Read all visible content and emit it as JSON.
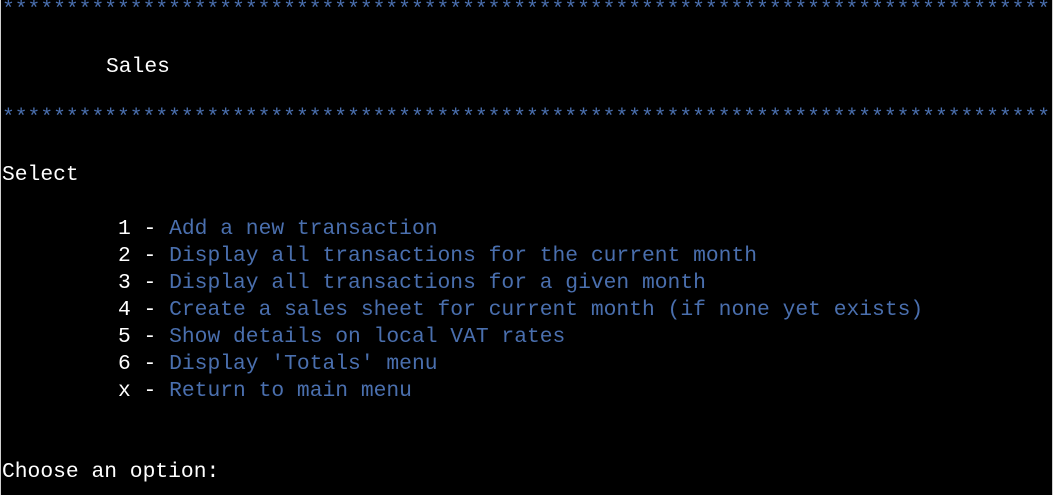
{
  "stars_top": "**********************************************************************************",
  "stars_bottom": "**********************************************************************************",
  "title": "Sales",
  "select_label": "Select",
  "menu": [
    {
      "key": "1",
      "sep": " - ",
      "label": "Add a new transaction"
    },
    {
      "key": "2",
      "sep": " - ",
      "label": "Display all transactions for the current month"
    },
    {
      "key": "3",
      "sep": " - ",
      "label": "Display all transactions for a given month"
    },
    {
      "key": "4",
      "sep": " - ",
      "label": "Create a sales sheet for current month (if none yet exists)"
    },
    {
      "key": "5",
      "sep": " - ",
      "label": "Show details on local VAT rates"
    },
    {
      "key": "6",
      "sep": " - ",
      "label": "Display 'Totals' menu"
    },
    {
      "key": "x",
      "sep": " - ",
      "label": "Return to main menu"
    }
  ],
  "prompt": "Choose an option:",
  "colors": {
    "background": "#000000",
    "text": "#ffffff",
    "accent": "#4a6fae"
  }
}
